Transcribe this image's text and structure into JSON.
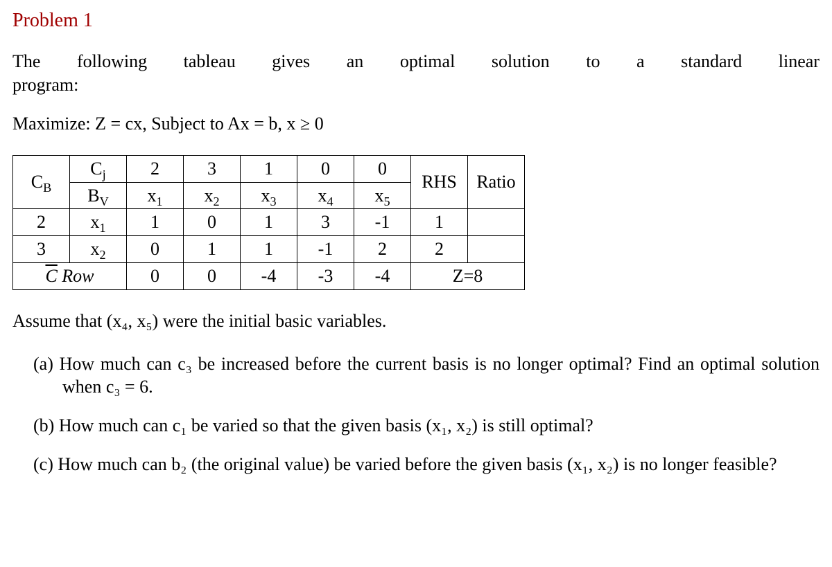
{
  "title": "Problem 1",
  "intro1_w1": "The",
  "intro1_w2": "following",
  "intro1_w3": "tableau",
  "intro1_w4": "gives",
  "intro1_w5": "an",
  "intro1_w6": "optimal",
  "intro1_w7": "solution",
  "intro1_w8": "to",
  "intro1_w9": "a",
  "intro1_w10": "standard",
  "intro1_w11": "linear",
  "intro2": "program:",
  "maximize": "Maximize: Z = cx, Subject to Ax = b, x ≥ 0",
  "tableau": {
    "header1": {
      "cb_blank": "",
      "bv_label": "C",
      "bv_sub": "j",
      "c": [
        "2",
        "3",
        "1",
        "0",
        "0"
      ],
      "rhs_blank": "",
      "ratio_blank": ""
    },
    "header2": {
      "cb": "C",
      "cb_sub": "B",
      "bv": "B",
      "bv_sub": "V",
      "x": [
        "x",
        "x",
        "x",
        "x",
        "x"
      ],
      "xsub": [
        "1",
        "2",
        "3",
        "4",
        "5"
      ],
      "rhs": "RHS",
      "ratio": "Ratio"
    },
    "rows": [
      {
        "cb": "2",
        "bv": "x",
        "bv_sub": "1",
        "vals": [
          "1",
          "0",
          "1",
          "3",
          "-1"
        ],
        "rhs": "1",
        "ratio": ""
      },
      {
        "cb": "3",
        "bv": "x",
        "bv_sub": "2",
        "vals": [
          "0",
          "1",
          "1",
          "-1",
          "2"
        ],
        "rhs": "2",
        "ratio": ""
      }
    ],
    "crow": {
      "label_pre": "C",
      "label_post": " Row",
      "vals": [
        "0",
        "0",
        "-4",
        "-3",
        "-4"
      ],
      "z": "Z=8"
    }
  },
  "assume": "Assume that (x₄, x₅) were the initial basic variables.",
  "parts": {
    "a": "(a) How much can c₃ be increased before the current basis is no longer optimal? Find an optimal solution when c₃ = 6.",
    "b": "(b) How much can c₁ be varied so that the given basis (x₁, x₂) is still optimal?",
    "c": "(c) How much can b₂ (the original value) be varied before the given basis (x₁, x₂) is no longer feasible?"
  }
}
